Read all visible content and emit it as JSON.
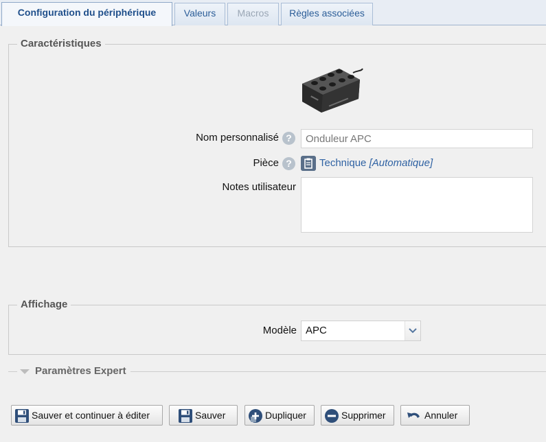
{
  "tabs": [
    {
      "label": "Configuration du périphérique",
      "state": "active"
    },
    {
      "label": "Valeurs",
      "state": "normal"
    },
    {
      "label": "Macros",
      "state": "disabled"
    },
    {
      "label": "Règles associées",
      "state": "normal"
    }
  ],
  "characteristics": {
    "legend": "Caractéristiques",
    "name_label": "Nom personnalisé",
    "name_value": "Onduleur APC",
    "room_label": "Pièce",
    "room_value": "Technique",
    "room_auto": "[Automatique]",
    "notes_label": "Notes utilisateur",
    "notes_value": ""
  },
  "display": {
    "legend": "Affichage",
    "model_label": "Modèle",
    "model_value": "APC"
  },
  "expert": {
    "label": "Paramètres Expert"
  },
  "buttons": {
    "save_continue": "Sauver et continuer à éditer",
    "save": "Sauver",
    "duplicate": "Dupliquer",
    "delete": "Supprimer",
    "cancel": "Annuler"
  },
  "icons": {
    "help": "help-icon",
    "room": "clipboard-icon",
    "save": "floppy-disk-icon",
    "duplicate": "plus-circle-icon",
    "delete": "minus-circle-icon",
    "cancel": "undo-arrow-icon"
  },
  "colors": {
    "accent": "#2f62a3",
    "icon_dark": "#2f4f7a"
  }
}
